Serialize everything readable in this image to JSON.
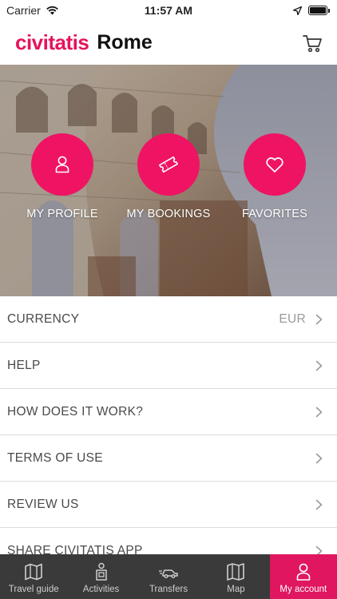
{
  "status_bar": {
    "carrier": "Carrier",
    "time": "11:57 AM",
    "icons": [
      "wifi-icon",
      "location-arrow-icon",
      "battery-icon"
    ]
  },
  "header": {
    "brand": "civitatis",
    "city": "Rome",
    "cart_icon": "cart-icon"
  },
  "shortcuts": [
    {
      "label": "MY PROFILE",
      "icon": "user-icon"
    },
    {
      "label": "MY BOOKINGS",
      "icon": "ticket-icon"
    },
    {
      "label": "FAVORITES",
      "icon": "heart-icon"
    }
  ],
  "menu": [
    {
      "label": "CURRENCY",
      "value": "EUR"
    },
    {
      "label": "HELP",
      "value": ""
    },
    {
      "label": "HOW DOES IT WORK?",
      "value": ""
    },
    {
      "label": "TERMS OF USE",
      "value": ""
    },
    {
      "label": "REVIEW US",
      "value": ""
    },
    {
      "label": "SHARE CIVITATIS APP",
      "value": ""
    }
  ],
  "tabs": [
    {
      "label": "Travel guide",
      "icon": "map-book-icon",
      "active": false
    },
    {
      "label": "Activities",
      "icon": "activities-icon",
      "active": false
    },
    {
      "label": "Transfers",
      "icon": "car-icon",
      "active": false
    },
    {
      "label": "Map",
      "icon": "map-icon",
      "active": false
    },
    {
      "label": "My account",
      "icon": "user-icon",
      "active": true
    }
  ],
  "colors": {
    "brand": "#e5135c",
    "button": "#ef1463",
    "tab_bar": "#3a3a3a",
    "tab_active": "#e01660"
  }
}
